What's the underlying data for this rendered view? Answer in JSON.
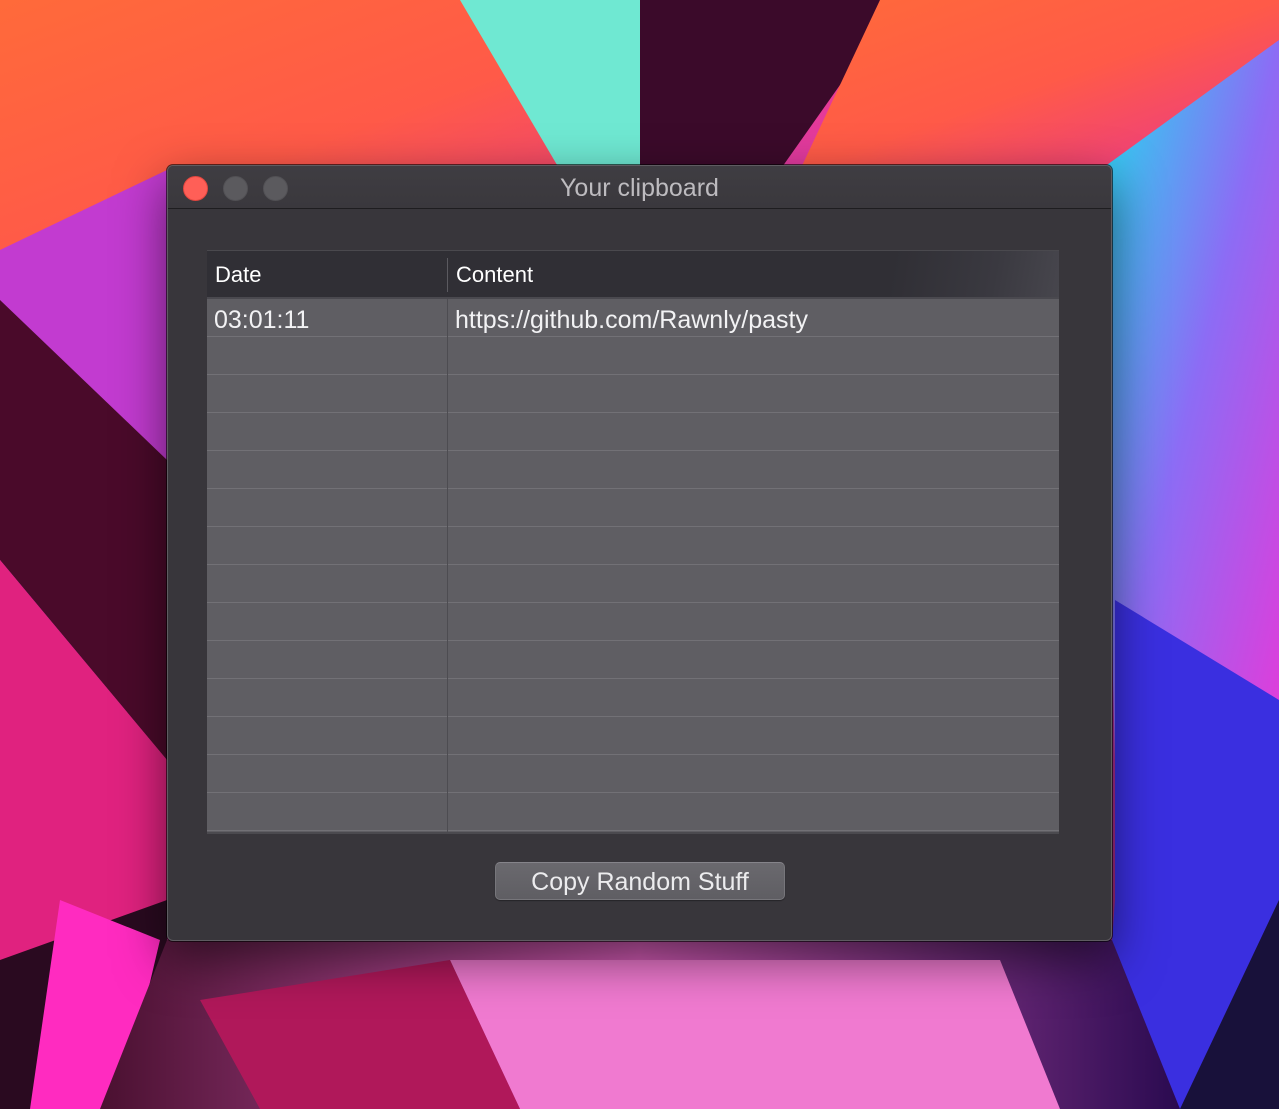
{
  "window": {
    "title": "Your clipboard"
  },
  "table": {
    "columns": [
      "Date",
      "Content"
    ],
    "rows": [
      {
        "date": "03:01:11",
        "content": "https://github.com/Rawnly/pasty"
      },
      {
        "date": "",
        "content": ""
      },
      {
        "date": "",
        "content": ""
      },
      {
        "date": "",
        "content": ""
      },
      {
        "date": "",
        "content": ""
      },
      {
        "date": "",
        "content": ""
      },
      {
        "date": "",
        "content": ""
      },
      {
        "date": "",
        "content": ""
      },
      {
        "date": "",
        "content": ""
      },
      {
        "date": "",
        "content": ""
      },
      {
        "date": "",
        "content": ""
      },
      {
        "date": "",
        "content": ""
      },
      {
        "date": "",
        "content": ""
      },
      {
        "date": "",
        "content": ""
      }
    ]
  },
  "actions": {
    "copy_label": "Copy Random Stuff"
  },
  "colors": {
    "close_button": "#ff5f57",
    "inactive_button": "#5b5a5e",
    "window_background": "#38363b",
    "table_background": "#5f5e63"
  }
}
